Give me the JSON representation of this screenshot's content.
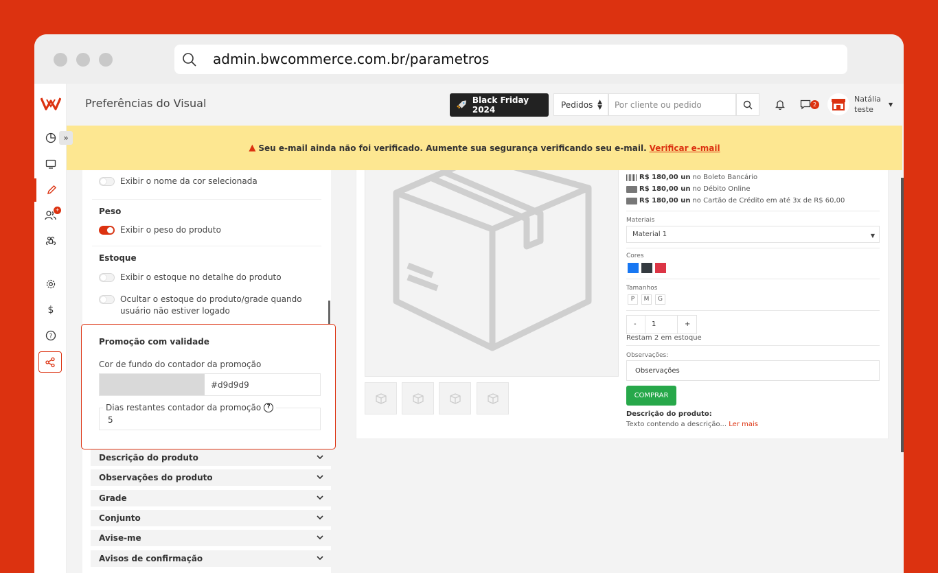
{
  "browser": {
    "url": "admin.bwcommerce.com.br/parametros"
  },
  "header": {
    "page_title": "Preferências do Visual",
    "promo_button": "Black Friday 2024",
    "search_type": "Pedidos",
    "search_placeholder": "Por cliente ou pedido",
    "messages_count": "2",
    "user_name": "Natália",
    "user_store": "teste"
  },
  "sidebar": {
    "users_badge": "+"
  },
  "alert": {
    "message": "Seu e-mail ainda não foi verificado. Aumente sua segurança verificando seu e-mail.",
    "link": "Verificar e-mail"
  },
  "settings": {
    "show_color_name": "Exibir o nome da cor selecionada",
    "weight_title": "Peso",
    "show_weight": "Exibir o peso do produto",
    "stock_title": "Estoque",
    "show_stock": "Exibir o estoque no detalhe do produto",
    "hide_stock": "Ocultar o estoque do produto/grade quando usuário não estiver logado",
    "toggles": {
      "color_name": false,
      "weight": true,
      "stock": false,
      "hide_stock": false
    }
  },
  "promo": {
    "title": "Promoção com validade",
    "bg_label": "Cor de fundo do contador da promoção",
    "bg_color": "#d9d9d9",
    "days_label": "Dias restantes contador da promoção",
    "days_value": "5"
  },
  "accordions": [
    "Descrição do produto",
    "Observações do produto",
    "Grade",
    "Conjunto",
    "Avise-me",
    "Avisos de confirmação"
  ],
  "product": {
    "payments": [
      {
        "price": "R$ 180,00 un",
        "method": "no Boleto Bancário"
      },
      {
        "price": "R$ 180,00 un",
        "method": "no Débito Online"
      },
      {
        "price": "R$ 180,00 un",
        "method": "no Cartão de Crédito em até 3x de R$ 60,00"
      }
    ],
    "materials_label": "Materiais",
    "material_value": "Material 1",
    "colors_label": "Cores",
    "colors": [
      "#1877f2",
      "#343a40",
      "#dc3545"
    ],
    "sizes_label": "Tamanhos",
    "sizes": [
      "P",
      "M",
      "G"
    ],
    "qty_minus": "-",
    "qty_value": "1",
    "qty_plus": "+",
    "stock_text": "Restam 2 em estoque",
    "obs_label": "Observações:",
    "obs_placeholder": "Observações",
    "buy_label": "COMPRAR",
    "desc_title": "Descrição do produto:",
    "desc_text": "Texto contendo a descrição...",
    "read_more": "Ler mais"
  }
}
